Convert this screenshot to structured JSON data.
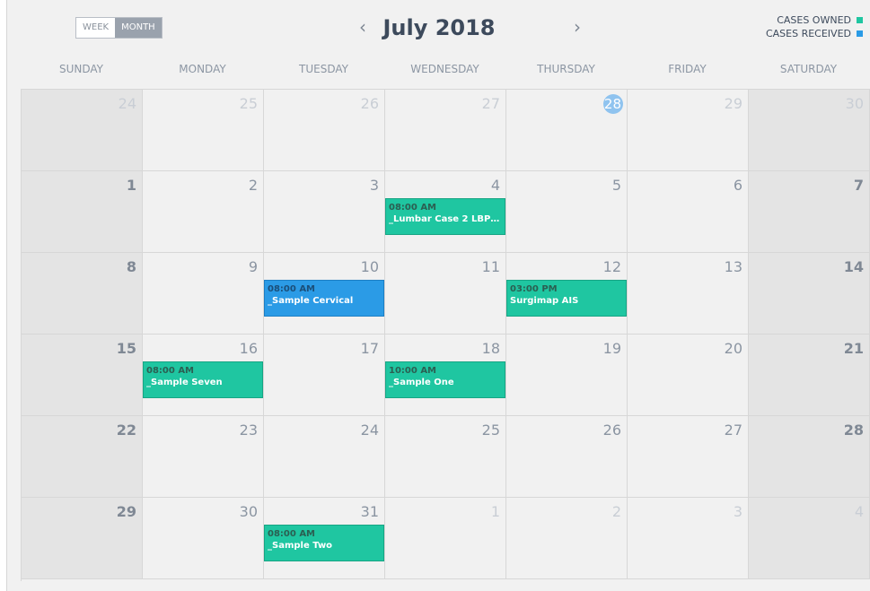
{
  "toolbar": {
    "week_label": "WEEK",
    "month_label": "MONTH"
  },
  "header": {
    "title": "July 2018",
    "prev": "‹",
    "next": "›"
  },
  "legend": {
    "owned_label": "CASES OWNED",
    "received_label": "CASES RECEIVED",
    "owned_color": "#1fc6a1",
    "received_color": "#2b9be6"
  },
  "weekdays": [
    "SUNDAY",
    "MONDAY",
    "TUESDAY",
    "WEDNESDAY",
    "THURSDAY",
    "FRIDAY",
    "SATURDAY"
  ],
  "days": [
    {
      "n": "24",
      "other": true
    },
    {
      "n": "25",
      "other": true
    },
    {
      "n": "26",
      "other": true
    },
    {
      "n": "27",
      "other": true
    },
    {
      "n": "28",
      "other": true,
      "today": true
    },
    {
      "n": "29",
      "other": true
    },
    {
      "n": "30",
      "other": true
    },
    {
      "n": "1"
    },
    {
      "n": "2"
    },
    {
      "n": "3"
    },
    {
      "n": "4",
      "event": {
        "time": "08:00 AM",
        "title": "_Lumbar Case 2 LBP ...",
        "kind": "owned"
      }
    },
    {
      "n": "5"
    },
    {
      "n": "6"
    },
    {
      "n": "7"
    },
    {
      "n": "8"
    },
    {
      "n": "9"
    },
    {
      "n": "10",
      "event": {
        "time": "08:00 AM",
        "title": "_Sample Cervical",
        "kind": "received"
      }
    },
    {
      "n": "11"
    },
    {
      "n": "12",
      "event": {
        "time": "03:00 PM",
        "title": "Surgimap AIS",
        "kind": "owned"
      }
    },
    {
      "n": "13"
    },
    {
      "n": "14"
    },
    {
      "n": "15"
    },
    {
      "n": "16",
      "event": {
        "time": "08:00 AM",
        "title": "_Sample Seven",
        "kind": "owned"
      }
    },
    {
      "n": "17"
    },
    {
      "n": "18",
      "event": {
        "time": "10:00 AM",
        "title": "_Sample One",
        "kind": "owned"
      }
    },
    {
      "n": "19"
    },
    {
      "n": "20"
    },
    {
      "n": "21"
    },
    {
      "n": "22"
    },
    {
      "n": "23"
    },
    {
      "n": "24"
    },
    {
      "n": "25"
    },
    {
      "n": "26"
    },
    {
      "n": "27"
    },
    {
      "n": "28"
    },
    {
      "n": "29"
    },
    {
      "n": "30"
    },
    {
      "n": "31",
      "event": {
        "time": "08:00 AM",
        "title": "_Sample Two",
        "kind": "owned"
      }
    },
    {
      "n": "1",
      "other": true
    },
    {
      "n": "2",
      "other": true
    },
    {
      "n": "3",
      "other": true
    },
    {
      "n": "4",
      "other": true
    }
  ]
}
